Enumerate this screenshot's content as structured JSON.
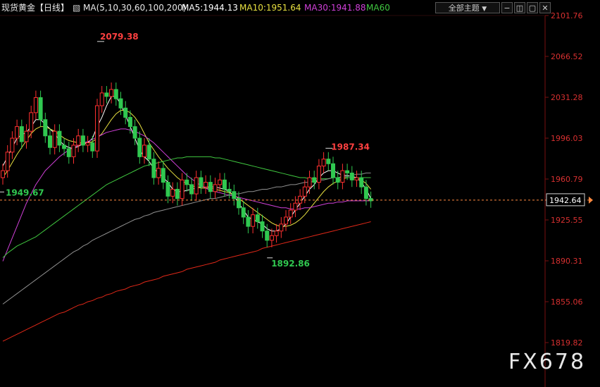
{
  "header": {
    "symbol": "现货黄金",
    "period": "【日线】",
    "ma_label": "MA(5,10,30,60,100,200)",
    "ma5": "MA5:1944.13",
    "ma10": "MA10:1951.64",
    "ma30": "MA30:1941.88",
    "ma60": "MA60",
    "theme_button": "全部主题",
    "theme_arrow": "▼",
    "colors": {
      "ma5": "#ffffff",
      "ma10": "#e8e040",
      "ma30": "#d040d8",
      "ma60": "#40c840"
    }
  },
  "watermark": "FX678",
  "chart_data": {
    "type": "candlestick",
    "y_axis_ticks": [
      2101.76,
      2066.52,
      2031.28,
      1996.03,
      1960.79,
      1925.55,
      1890.31,
      1855.06,
      1819.82
    ],
    "ylim": [
      1819.82,
      2101.76
    ],
    "current_price": 1942.64,
    "annotations": {
      "high": "2079.38",
      "left_marker": "1949.67",
      "low": "1892.86",
      "recent_high": "1987.34"
    },
    "candles_close": [
      1968,
      1984,
      1996,
      2006,
      1993,
      2002,
      2018,
      2031,
      2012,
      1998,
      1988,
      2002,
      1990,
      1987,
      1980,
      1990,
      1998,
      1990,
      1992,
      1985,
      2024,
      2035,
      2032,
      2038,
      2030,
      2022,
      2014,
      2006,
      1996,
      1980,
      1990,
      1978,
      1962,
      1970,
      1958,
      1946,
      1952,
      1944,
      1960,
      1956,
      1948,
      1962,
      1954,
      1958,
      1950,
      1956,
      1960,
      1952,
      1950,
      1944,
      1936,
      1928,
      1920,
      1930,
      1924,
      1916,
      1908,
      1912,
      1916,
      1922,
      1928,
      1934,
      1940,
      1946,
      1954,
      1962,
      1958,
      1972,
      1978,
      1974,
      1962,
      1958,
      1968,
      1966,
      1960,
      1962,
      1954,
      1944,
      1942
    ],
    "series": [
      {
        "name": "MA5",
        "values": [
          1972,
          1980,
          1988,
          1996,
          1999,
          2001,
          2006,
          2012,
          2012,
          2008,
          2004,
          2000,
          1994,
          1990,
          1988,
          1987,
          1989,
          1991,
          1992,
          1996,
          2006,
          2014,
          2024,
          2032,
          2032,
          2025,
          2016,
          2006,
          1996,
          1986,
          1980,
          1976,
          1970,
          1966,
          1962,
          1958,
          1952,
          1950,
          1950,
          1951,
          1952,
          1953,
          1954,
          1954,
          1954,
          1954,
          1953,
          1952,
          1950,
          1946,
          1940,
          1934,
          1928,
          1926,
          1924,
          1922,
          1918,
          1916,
          1916,
          1918,
          1922,
          1928,
          1934,
          1940,
          1946,
          1952,
          1956,
          1962,
          1966,
          1968,
          1968,
          1966,
          1964,
          1964,
          1963,
          1962,
          1958,
          1952,
          1944
        ]
      },
      {
        "name": "MA10",
        "values": [
          1962,
          1968,
          1975,
          1982,
          1988,
          1994,
          2000,
          2004,
          2006,
          2006,
          2004,
          2002,
          1999,
          1996,
          1994,
          1993,
          1992,
          1992,
          1992,
          1993,
          1996,
          2000,
          2006,
          2012,
          2017,
          2020,
          2020,
          2018,
          2014,
          2008,
          2000,
          1992,
          1986,
          1980,
          1975,
          1970,
          1966,
          1962,
          1959,
          1957,
          1955,
          1954,
          1953,
          1953,
          1953,
          1952,
          1951,
          1950,
          1949,
          1947,
          1944,
          1941,
          1938,
          1935,
          1932,
          1929,
          1926,
          1923,
          1921,
          1920,
          1920,
          1921,
          1923,
          1926,
          1930,
          1935,
          1940,
          1945,
          1950,
          1954,
          1957,
          1959,
          1961,
          1962,
          1962,
          1962,
          1960,
          1957,
          1952
        ]
      },
      {
        "name": "MA30",
        "values": [
          1890,
          1900,
          1910,
          1920,
          1930,
          1940,
          1948,
          1956,
          1962,
          1968,
          1972,
          1976,
          1980,
          1983,
          1986,
          1988,
          1990,
          1992,
          1993,
          1995,
          1997,
          1999,
          2001,
          2002,
          2003,
          2004,
          2004,
          2003,
          2002,
          2000,
          1998,
          1995,
          1992,
          1988,
          1984,
          1980,
          1976,
          1972,
          1968,
          1964,
          1961,
          1958,
          1955,
          1953,
          1951,
          1950,
          1949,
          1948,
          1947,
          1946,
          1945,
          1944,
          1943,
          1942,
          1941,
          1940,
          1939,
          1938,
          1937,
          1936,
          1936,
          1935,
          1935,
          1935,
          1936,
          1936,
          1937,
          1938,
          1939,
          1940,
          1940,
          1941,
          1941,
          1942,
          1942,
          1942,
          1942,
          1942,
          1942
        ]
      },
      {
        "name": "MA60",
        "values": [
          1893,
          1897,
          1900,
          1903,
          1905,
          1907,
          1909,
          1911,
          1914,
          1917,
          1920,
          1923,
          1926,
          1929,
          1932,
          1935,
          1938,
          1941,
          1944,
          1947,
          1950,
          1953,
          1956,
          1958,
          1960,
          1962,
          1964,
          1966,
          1968,
          1970,
          1972,
          1973,
          1974,
          1975,
          1976,
          1977,
          1978,
          1979,
          1979,
          1980,
          1980,
          1980,
          1980,
          1980,
          1980,
          1979,
          1979,
          1978,
          1977,
          1976,
          1975,
          1974,
          1973,
          1972,
          1971,
          1970,
          1969,
          1968,
          1967,
          1966,
          1965,
          1964,
          1963,
          1962,
          1962,
          1961,
          1961,
          1961,
          1961,
          1961,
          1962,
          1962,
          1962,
          1962,
          1962,
          1962,
          1962,
          1962,
          1962
        ]
      },
      {
        "name": "MA100",
        "values": [
          1853,
          1856,
          1859,
          1862,
          1865,
          1868,
          1871,
          1874,
          1877,
          1880,
          1883,
          1886,
          1889,
          1892,
          1895,
          1898,
          1900,
          1903,
          1905,
          1908,
          1910,
          1912,
          1914,
          1916,
          1918,
          1920,
          1922,
          1924,
          1926,
          1927,
          1929,
          1930,
          1932,
          1933,
          1934,
          1935,
          1936,
          1937,
          1938,
          1939,
          1940,
          1941,
          1942,
          1943,
          1944,
          1944,
          1945,
          1946,
          1947,
          1948,
          1948,
          1949,
          1950,
          1950,
          1951,
          1952,
          1952,
          1953,
          1954,
          1954,
          1955,
          1956,
          1956,
          1957,
          1958,
          1958,
          1959,
          1960,
          1960,
          1961,
          1962,
          1962,
          1963,
          1963,
          1964,
          1965,
          1965,
          1966,
          1966
        ]
      },
      {
        "name": "MA200",
        "values": [
          1821,
          1823,
          1825,
          1827,
          1829,
          1831,
          1833,
          1835,
          1837,
          1839,
          1841,
          1843,
          1845,
          1846,
          1848,
          1850,
          1852,
          1853,
          1855,
          1856,
          1858,
          1859,
          1861,
          1862,
          1864,
          1865,
          1866,
          1868,
          1869,
          1870,
          1872,
          1873,
          1874,
          1875,
          1877,
          1878,
          1879,
          1880,
          1881,
          1883,
          1884,
          1885,
          1886,
          1887,
          1888,
          1889,
          1891,
          1892,
          1893,
          1894,
          1895,
          1896,
          1897,
          1898,
          1899,
          1901,
          1902,
          1903,
          1904,
          1905,
          1906,
          1907,
          1908,
          1909,
          1910,
          1911,
          1912,
          1913,
          1914,
          1915,
          1916,
          1917,
          1918,
          1919,
          1920,
          1921,
          1922,
          1923,
          1924
        ]
      }
    ]
  }
}
